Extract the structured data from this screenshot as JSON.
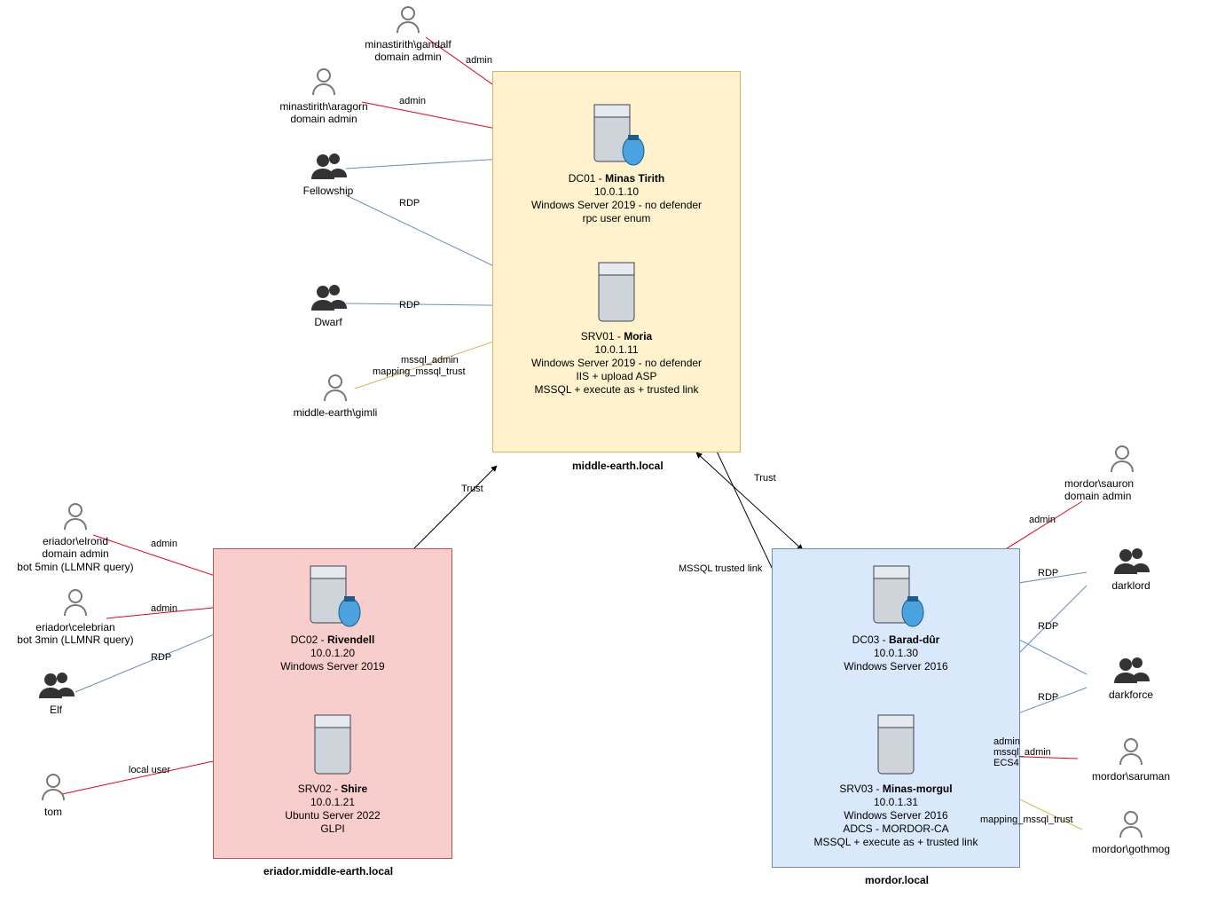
{
  "domains": {
    "middle": {
      "label": "middle-earth.local"
    },
    "eriador": {
      "label": "eriador.middle-earth.local"
    },
    "mordor": {
      "label": "mordor.local"
    }
  },
  "servers": {
    "dc01": {
      "line1_pre": "DC01 - ",
      "line1_bold": "Minas Tirith",
      "ip": "10.0.1.10",
      "os": "Windows Server 2019 - no defender",
      "extra1": "rpc user enum"
    },
    "srv01": {
      "line1_pre": "SRV01 - ",
      "line1_bold": "Moria",
      "ip": "10.0.1.11",
      "os": "Windows Server 2019 - no defender",
      "extra1": "IIS + upload ASP",
      "extra2": "MSSQL + execute as + trusted link"
    },
    "dc02": {
      "line1_pre": "DC02 - ",
      "line1_bold": "Rivendell",
      "ip": "10.0.1.20",
      "os": "Windows Server 2019"
    },
    "srv02": {
      "line1_pre": "SRV02 - ",
      "line1_bold": "Shire",
      "ip": "10.0.1.21",
      "os": "Ubuntu Server 2022",
      "extra1": "GLPI"
    },
    "dc03": {
      "line1_pre": "DC03 - ",
      "line1_bold": "Barad-dûr",
      "ip": "10.0.1.30",
      "os": "Windows Server 2016"
    },
    "srv03": {
      "line1_pre": "SRV03 - ",
      "line1_bold": "Minas-morgul",
      "ip": "10.0.1.31",
      "os": "Windows Server 2016",
      "extra1": "ADCS - MORDOR-CA",
      "extra2": "MSSQL + execute as + trusted link"
    }
  },
  "actors": {
    "gandalf": {
      "l1": "minastirith\\gandalf",
      "l2": "domain admin"
    },
    "aragorn": {
      "l1": "minastirith\\aragorn",
      "l2": "domain admin"
    },
    "fellowship": {
      "l1": "Fellowship"
    },
    "dwarf": {
      "l1": "Dwarf"
    },
    "gimli": {
      "l1": "middle-earth\\gimli"
    },
    "elrond": {
      "l1": "eriador\\elrond",
      "l2": "domain admin",
      "l3": "bot 5min (LLMNR query)"
    },
    "celebrian": {
      "l1": "eriador\\celebrian",
      "l2": "bot 3min (LLMNR query)"
    },
    "elf": {
      "l1": "Elf"
    },
    "tom": {
      "l1": "tom"
    },
    "sauron": {
      "l1": "mordor\\sauron",
      "l2": "domain admin"
    },
    "darklord": {
      "l1": "darklord"
    },
    "darkforce": {
      "l1": "darkforce"
    },
    "saruman": {
      "l1": "mordor\\saruman"
    },
    "gothmog": {
      "l1": "mordor\\gothmog"
    }
  },
  "edges": {
    "admin": "admin",
    "rdp": "RDP",
    "mssql_admin": "mssql_admin",
    "mapping_mssql_trust": "mapping_mssql_trust",
    "trust": "Trust",
    "mssql_trusted_link": "MSSQL trusted link",
    "local_user": "local user",
    "saruman_lines": "admin\nmssql_admin\nECS4"
  }
}
